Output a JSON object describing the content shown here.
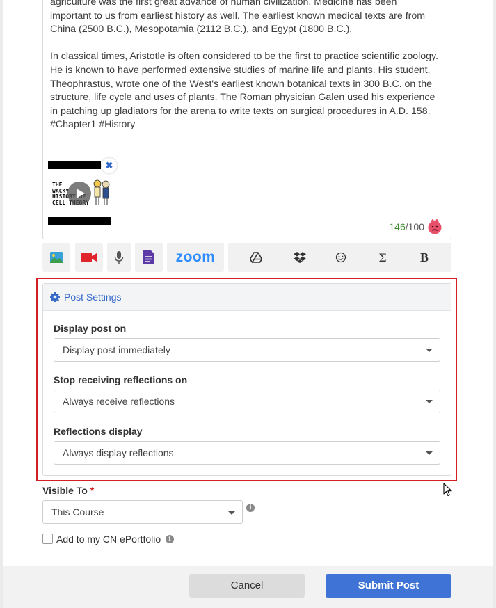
{
  "post": {
    "paragraph1": "agriculture was the first great advance of human civilization. Medicine has been important to us from earliest history as well. The earliest known medical texts are from China (2500 B.C.), Mesopotamia (2112 B.C.), and Egypt (1800 B.C.).",
    "paragraph2": "In classical times, Aristotle is often considered to be the first to practice scientific zoology. He is known to have performed extensive studies of marine life and plants. His student, Theophrastus, wrote one of the West's earliest known botanical texts in 300 B.C. on the structure, life cycle and uses of plants. The Roman physician Galen used his experience in patching up gladiators for the arena to write texts on surgical procedures in A.D. 158. #Chapter1 #History",
    "attachment_title": "THE\nWACKY\nHISTORY OF\nCELL THEORY",
    "counter_used": "146",
    "counter_max": "/100"
  },
  "toolbar": {
    "items": [
      "image-icon",
      "video-icon",
      "microphone-icon",
      "document-icon",
      "zoom",
      "google-drive-icon",
      "dropbox-icon",
      "smiley-icon",
      "sigma-icon",
      "bold-icon"
    ],
    "zoom_label": "zoom",
    "sigma": "Σ",
    "bold": "B"
  },
  "settings": {
    "title": "Post Settings",
    "display_on_label": "Display post on",
    "display_on_value": "Display post immediately",
    "stop_label": "Stop receiving reflections on",
    "stop_value": "Always receive reflections",
    "reflections_label": "Reflections display",
    "reflections_value": "Always display reflections"
  },
  "visibility": {
    "label": "Visible To",
    "required_mark": "*",
    "value": "This Course",
    "portfolio_label": "Add to my CN ePortfolio"
  },
  "footer": {
    "cancel_label": "Cancel",
    "submit_label": "Submit Post"
  },
  "colors": {
    "accent": "#3f74d6",
    "highlight_border": "#d21f26",
    "video_red": "#e0242b",
    "doc_purple": "#5b3aa8",
    "zoom_blue": "#2d8cff",
    "counter_green": "#3e8e2e"
  }
}
